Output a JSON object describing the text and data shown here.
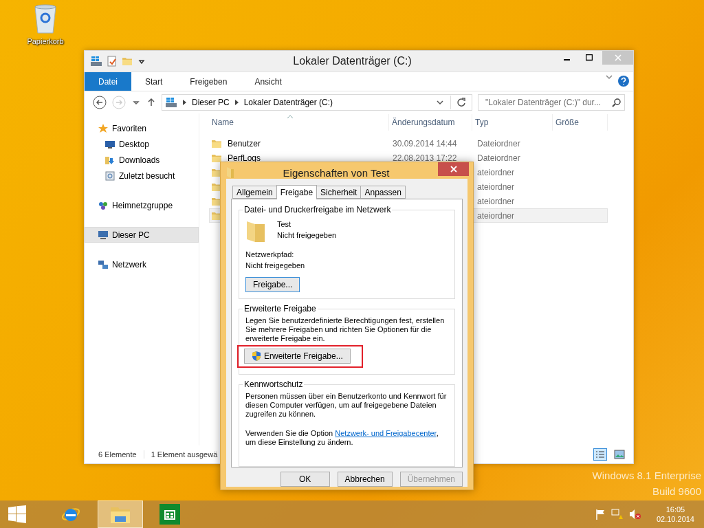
{
  "desktop_icons": [
    {
      "label": "Papierkorb"
    }
  ],
  "explorer": {
    "title": "Lokaler Datenträger (C:)",
    "ribbon_tabs": [
      {
        "label": "Datei",
        "selected": true
      },
      {
        "label": "Start",
        "selected": false
      },
      {
        "label": "Freigeben",
        "selected": false
      },
      {
        "label": "Ansicht",
        "selected": false
      }
    ],
    "breadcrumb": [
      "Dieser PC",
      "Lokaler Datenträger (C:)"
    ],
    "search": {
      "placeholder": "\"Lokaler Datenträger (C:)\" dur..."
    },
    "nav": [
      {
        "label": "Favoriten",
        "kind": "star",
        "selected": false,
        "children": [
          {
            "label": "Desktop",
            "kind": "desktop",
            "selected": false
          },
          {
            "label": "Downloads",
            "kind": "downloads",
            "selected": false
          },
          {
            "label": "Zuletzt besucht",
            "kind": "recent",
            "selected": false
          }
        ]
      },
      {
        "label": "Heimnetzgruppe",
        "kind": "homegroup",
        "selected": false
      },
      {
        "label": "Dieser PC",
        "kind": "pc",
        "selected": true
      },
      {
        "label": "Netzwerk",
        "kind": "network",
        "selected": false
      }
    ],
    "columns": [
      "Name",
      "Änderungsdatum",
      "Typ",
      "Größe"
    ],
    "rows": [
      {
        "name": "Benutzer",
        "date": "30.09.2014 14:44",
        "type": "Dateiordner",
        "selected": false
      },
      {
        "name": "PerfLogs",
        "date": "22.08.2013 17:22",
        "type": "Dateiordner",
        "selected": false
      },
      {
        "type": "ateiordner",
        "selected": false
      },
      {
        "type": "ateiordner",
        "selected": false
      },
      {
        "type": "ateiordner",
        "selected": false
      },
      {
        "type": "ateiordner",
        "selected": true
      }
    ],
    "status": [
      "6 Elemente",
      "1 Element ausgewä"
    ]
  },
  "dialog": {
    "title": "Eigenschaften von Test",
    "tabs": [
      {
        "label": "Allgemein",
        "selected": false
      },
      {
        "label": "Freigabe",
        "selected": true
      },
      {
        "label": "Sicherheit",
        "selected": false
      },
      {
        "label": "Anpassen",
        "selected": false
      }
    ],
    "network_sharing": {
      "title": "Datei- und Druckerfreigabe im Netzwerk",
      "folder": "Test",
      "state": "Nicht freigegeben",
      "path_label": "Netzwerkpfad:",
      "path": "Nicht freigegeben",
      "button": "Freigabe..."
    },
    "advanced": {
      "title": "Erweiterte Freigabe",
      "text": "Legen Sie benutzerdefinierte Berechtigungen fest, erstellen Sie mehrere Freigaben und richten Sie Optionen für die erweiterte Freigabe ein.",
      "button": "Erweiterte Freigabe...",
      "highlighted": true
    },
    "password": {
      "title": "Kennwortschutz",
      "text": "Personen müssen über ein Benutzerkonto und Kennwort für diesen Computer verfügen, um auf freigegebene Dateien zugreifen zu können.",
      "hint_before": "Verwenden Sie die Option ",
      "link": "Netzwerk- und Freigabecenter",
      "hint_after": ", um diese Einstellung zu ändern."
    },
    "buttons": [
      {
        "label": "OK",
        "disabled": false
      },
      {
        "label": "Abbrechen",
        "disabled": false
      },
      {
        "label": "Übernehmen",
        "disabled": true
      }
    ]
  },
  "watermark": [
    "Windows 8.1 Enterprise",
    "Build 9600"
  ],
  "taskbar": {
    "apps": [
      {
        "kind": "browser",
        "selected": false
      },
      {
        "kind": "explorer",
        "selected": true
      },
      {
        "kind": "store",
        "selected": false
      }
    ],
    "clock": {
      "time": "16:05",
      "date": "02.10.2014"
    }
  }
}
